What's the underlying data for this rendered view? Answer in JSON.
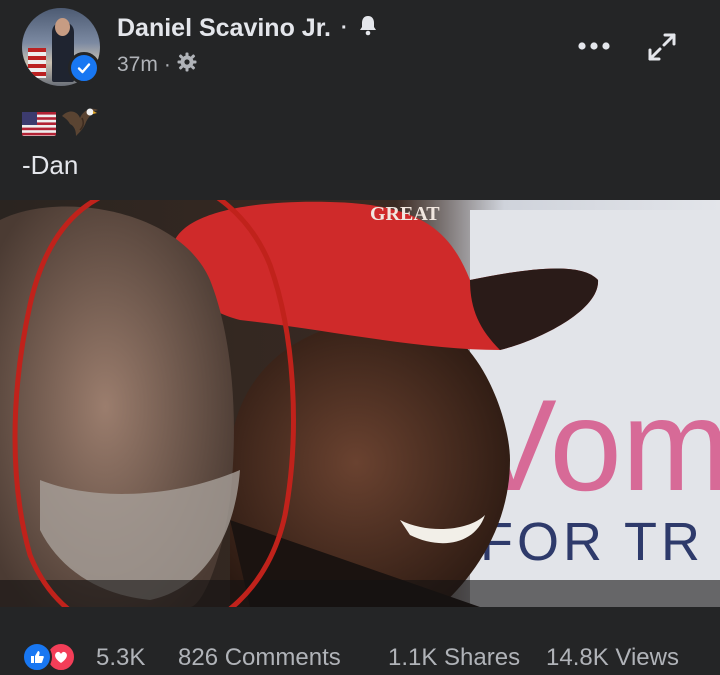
{
  "post": {
    "author": "Daniel Scavino Jr.",
    "separator": "·",
    "time": "37m",
    "time_sep": "·",
    "text": "-Dan",
    "emojis": [
      "us-flag-emoji",
      "eagle-emoji"
    ]
  },
  "video": {
    "cap_text": "GREAT",
    "sign_text_large": "Vom",
    "sign_text_small": "FOR TR"
  },
  "stats": {
    "reactions": "5.3K",
    "comments": "826 Comments",
    "shares": "1.1K Shares",
    "views": "14.8K Views"
  },
  "colors": {
    "accent": "#1877f2",
    "love": "#f33e58",
    "annotation_circle": "#c0221b",
    "background": "#242526"
  }
}
